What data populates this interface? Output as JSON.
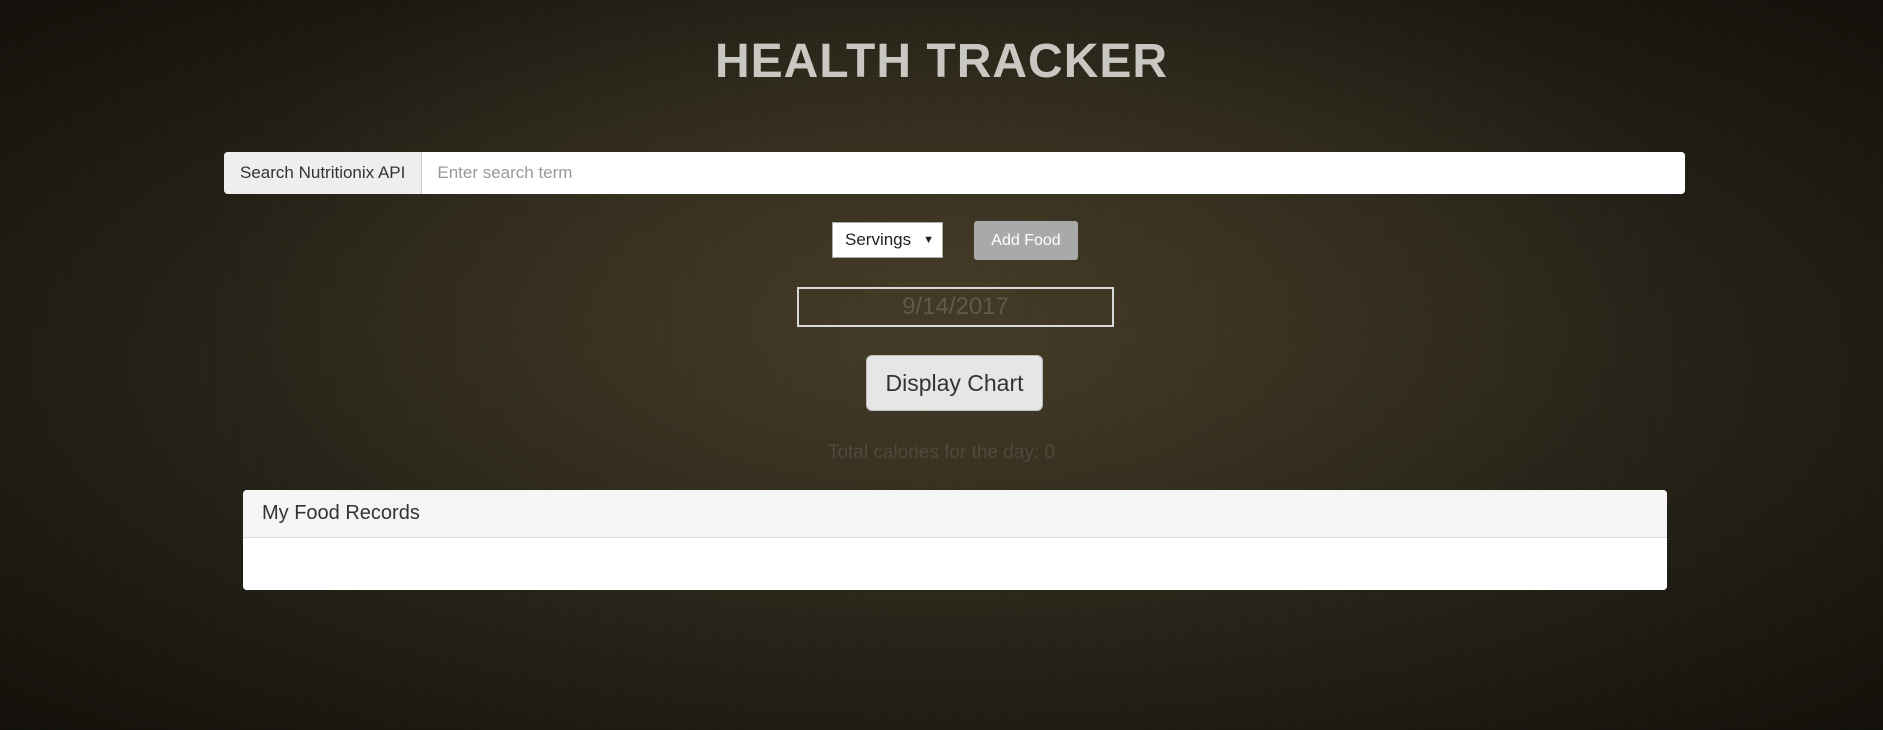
{
  "header": {
    "title": "HEALTH TRACKER"
  },
  "search": {
    "addon_label": "Search Nutritionix API",
    "placeholder": "Enter search term",
    "value": ""
  },
  "controls": {
    "servings_selected": "Servings",
    "add_food_label": "Add Food"
  },
  "date": {
    "value": "9/14/2017"
  },
  "chart_button": {
    "label": "Display Chart"
  },
  "summary": {
    "calories_text": "Total calories for the day: 0"
  },
  "records": {
    "heading": "My Food Records"
  },
  "colors": {
    "title": "#c9c7c2",
    "add_food_bg": "#a9a9a9",
    "panel_heading_bg": "#f5f5f5"
  }
}
